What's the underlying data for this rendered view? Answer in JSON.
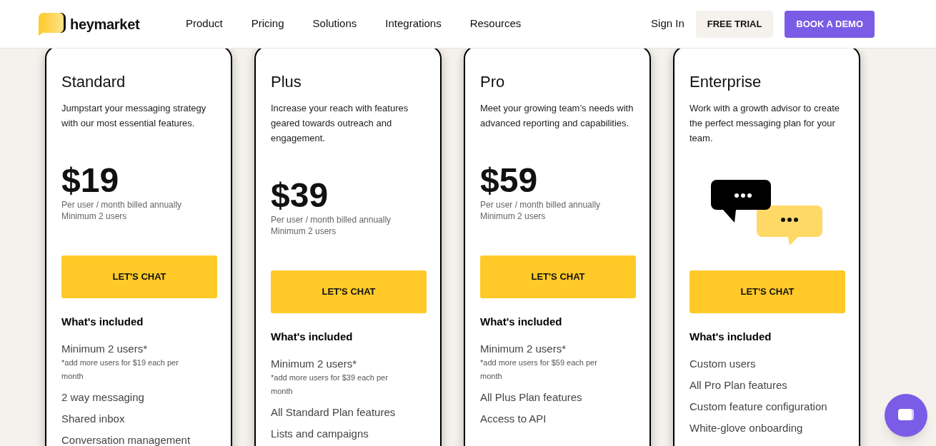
{
  "header": {
    "brand": "heymarket",
    "nav": [
      "Product",
      "Pricing",
      "Solutions",
      "Integrations",
      "Resources"
    ],
    "sign_in": "Sign In",
    "free_trial": "FREE TRIAL",
    "book_demo": "BOOK A DEMO"
  },
  "plans": [
    {
      "kind": "price",
      "name": "Standard",
      "description": "Jumpstart your messaging strategy with our most essential features.",
      "price": "$19",
      "billing": "Per user / month billed annually",
      "minimum": "Minimum 2 users",
      "cta": "LET'S CHAT",
      "included_title": "What's included",
      "features": [
        {
          "text": "Minimum 2 users*",
          "note": "*add more users for $19 each per month"
        },
        {
          "text": "2 way messaging"
        },
        {
          "text": "Shared inbox"
        },
        {
          "text": "Conversation management"
        }
      ]
    },
    {
      "kind": "price",
      "name": "Plus",
      "description": "Increase your reach with features geared towards outreach and engagement.",
      "price": "$39",
      "billing": "Per user / month billed annually",
      "minimum": "Minimum 2 users",
      "cta": "LET'S CHAT",
      "included_title": "What's included",
      "features": [
        {
          "text": "Minimum 2 users*",
          "note": "*add more users for $39 each per month"
        },
        {
          "text": "All Standard Plan features"
        },
        {
          "text": "Lists and campaigns"
        }
      ]
    },
    {
      "kind": "price",
      "name": "Pro",
      "description": "Meet your growing team’s needs with advanced reporting and capabilities.",
      "price": "$59",
      "billing": "Per user / month billed annually",
      "minimum": "Minimum 2 users",
      "cta": "LET'S CHAT",
      "included_title": "What's included",
      "features": [
        {
          "text": "Minimum 2 users*",
          "note": "*add more users for $59 each per month"
        },
        {
          "text": "All Plus Plan features"
        },
        {
          "text": "Access to API"
        }
      ]
    },
    {
      "kind": "illustration",
      "name": "Enterprise",
      "description": "Work with a growth advisor to create the perfect messaging plan for your team.",
      "cta": "LET'S CHAT",
      "included_title": "What's included",
      "features": [
        {
          "text": "Custom users"
        },
        {
          "text": "All Pro Plan features"
        },
        {
          "text": "Custom feature configuration"
        },
        {
          "text": "White-glove onboarding"
        }
      ]
    }
  ]
}
